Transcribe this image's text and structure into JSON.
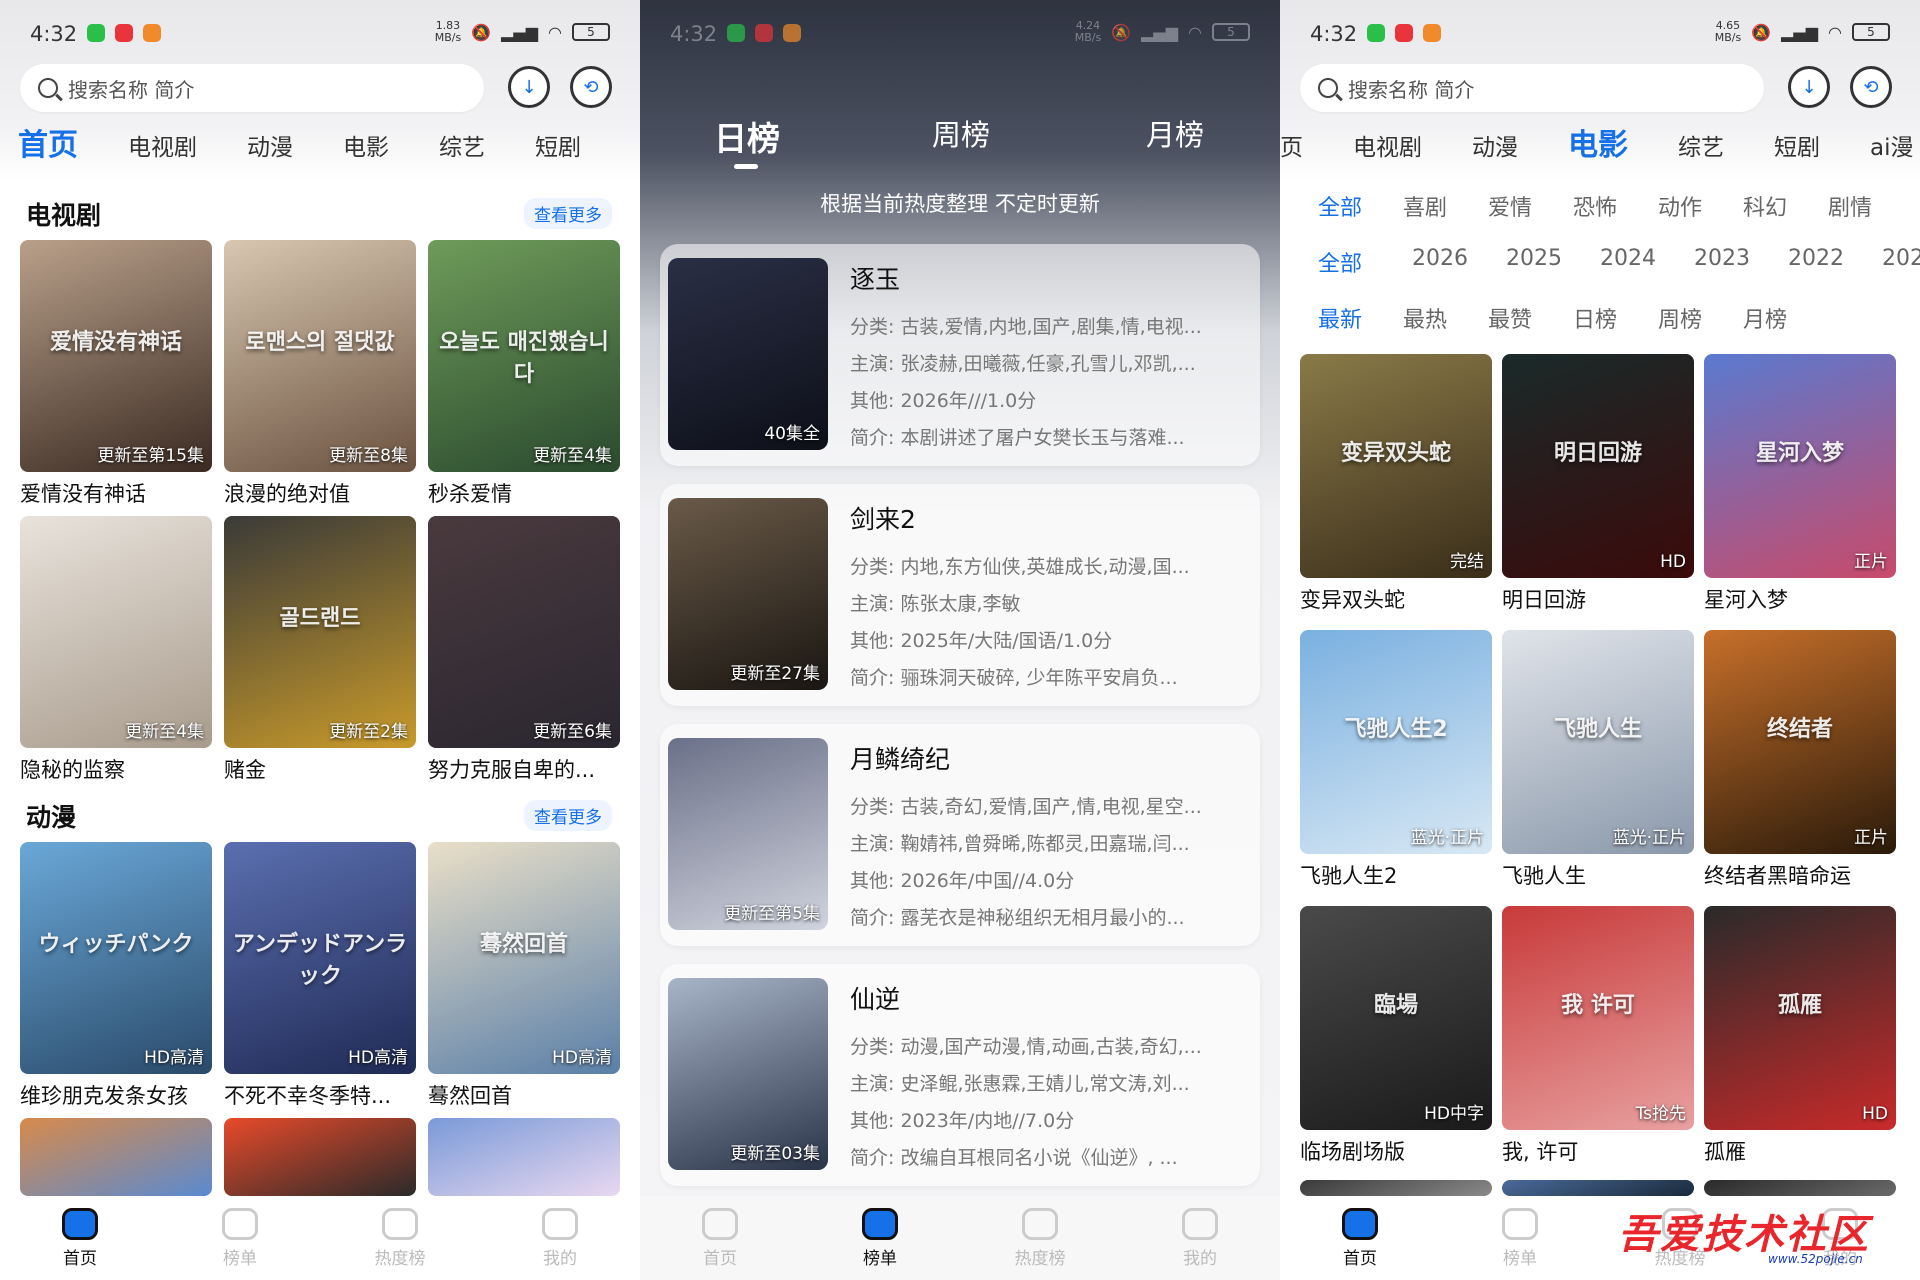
{
  "status": {
    "time": "4:32",
    "speed1": "1.83\nMB/s",
    "speed2": "4.24\nMB/s",
    "speed3": "4.65\nMB/s",
    "battery": "5"
  },
  "colors": {
    "accent": "#1670e8"
  },
  "home": {
    "search_placeholder": "搜索名称 简介",
    "tabs": [
      "首页",
      "电视剧",
      "动漫",
      "电影",
      "综艺",
      "短剧"
    ],
    "sections": [
      {
        "title": "电视剧",
        "more": "查看更多",
        "items": [
          {
            "title": "爱情没有神话",
            "badge": "更新至第15集",
            "poster_text": "爱情没有神话",
            "c1": "#b9a08a",
            "c2": "#3a2a22"
          },
          {
            "title": "浪漫的绝对值",
            "badge": "更新至8集",
            "poster_text": "로맨스의 절댓값",
            "c1": "#d8c7b0",
            "c2": "#6b5240"
          },
          {
            "title": "秒杀爱情",
            "badge": "更新至4集",
            "poster_text": "오늘도 매진했습니다",
            "c1": "#6f9b5a",
            "c2": "#2a4a2e"
          },
          {
            "title": "隐秘的监察",
            "badge": "更新至4集",
            "poster_text": "",
            "c1": "#e9e3dc",
            "c2": "#a89b8c"
          },
          {
            "title": "赌金",
            "badge": "更新至2集",
            "poster_text": "골드랜드",
            "c1": "#3a3a38",
            "c2": "#c89a2a"
          },
          {
            "title": "努力克服自卑的...",
            "badge": "更新至6集",
            "poster_text": "",
            "c1": "#4a3a3e",
            "c2": "#2a2630"
          }
        ]
      },
      {
        "title": "动漫",
        "more": "查看更多",
        "items": [
          {
            "title": "维珍朋克发条女孩",
            "badge": "HD高清",
            "poster_text": "ウィッチパンク",
            "c1": "#6aa8d8",
            "c2": "#2a4a6a"
          },
          {
            "title": "不死不幸冬季特...",
            "badge": "HD高清",
            "poster_text": "アンデッドアンラック",
            "c1": "#5b6fb0",
            "c2": "#1f2a55"
          },
          {
            "title": "蓦然回首",
            "badge": "HD高清",
            "poster_text": "蓦然回首",
            "c1": "#e9dfc8",
            "c2": "#5a7fa8"
          }
        ]
      }
    ],
    "extra_row": [
      {
        "c1": "#d88a4a",
        "c2": "#5a8ad0"
      },
      {
        "c1": "#e84a2a",
        "c2": "#2a2a2a"
      },
      {
        "c1": "#7a9ad8",
        "c2": "#e8d8f0"
      }
    ]
  },
  "rank": {
    "tabs": [
      "日榜",
      "周榜",
      "月榜"
    ],
    "subtitle": "根据当前热度整理 不定时更新",
    "items": [
      {
        "title": "逐玉",
        "badge": "40集全",
        "category": "分类:   古装,爱情,内地,国产,剧集,情,电视...",
        "cast": "主演:   张凌赫,田曦薇,任豪,孔雪儿,邓凯,...",
        "other": "其他:   2026年///1.0分",
        "intro": "简介:   本剧讲述了屠户女樊长玉与落难...",
        "c1": "#2a2f45",
        "c2": "#0d0f18"
      },
      {
        "title": "剑来2",
        "badge": "更新至27集",
        "category": "分类:   内地,东方仙侠,英雄成长,动漫,国...",
        "cast": "主演:   陈张太康,李敏",
        "other": "其他:   2025年/大陆/国语/1.0分",
        "intro": "简介:   骊珠洞天破碎, 少年陈平安肩负...",
        "c1": "#6a5a48",
        "c2": "#1a1612"
      },
      {
        "title": "月鳞绮纪",
        "badge": "更新至第5集",
        "category": "分类:   古装,奇幻,爱情,国产,情,电视,星空...",
        "cast": "主演:   鞠婧祎,曾舜晞,陈都灵,田嘉瑞,闫...",
        "other": "其他:   2026年/中国//4.0分",
        "intro": "简介:   露芜衣是神秘组织无相月最小的...",
        "c1": "#6a7088",
        "c2": "#d0d4de"
      },
      {
        "title": "仙逆",
        "badge": "更新至03集",
        "category": "分类:   动漫,国产动漫,情,动画,古装,奇幻,...",
        "cast": "主演:   史泽鲲,张惠霖,王婧儿,常文涛,刘...",
        "other": "其他:   2023年/内地//7.0分",
        "intro": "简介:   改编自耳根同名小说《仙逆》, ...",
        "c1": "#a8b4c8",
        "c2": "#2a3448"
      }
    ]
  },
  "movies": {
    "search_placeholder": "搜索名称 简介",
    "tabs": [
      "页",
      "电视剧",
      "动漫",
      "电影",
      "综艺",
      "短剧",
      "ai漫"
    ],
    "genres": [
      "全部",
      "喜剧",
      "爱情",
      "恐怖",
      "动作",
      "科幻",
      "剧情"
    ],
    "years": [
      "全部",
      "2026",
      "2025",
      "2024",
      "2023",
      "2022",
      "202"
    ],
    "sorts": [
      "最新",
      "最热",
      "最赞",
      "日榜",
      "周榜",
      "月榜"
    ],
    "items": [
      {
        "title": "变异双头蛇",
        "badge": "完结",
        "poster_text": "变异双头蛇",
        "c1": "#8a7a48",
        "c2": "#3a2e1a"
      },
      {
        "title": "明日回游",
        "badge": "HD",
        "poster_text": "明日回游",
        "c1": "#1a2a2a",
        "c2": "#3a0a0a"
      },
      {
        "title": "星河入梦",
        "badge": "正片",
        "poster_text": "星河入梦",
        "c1": "#5a7ad0",
        "c2": "#c84a6a"
      },
      {
        "title": "飞驰人生2",
        "badge": "蓝光·正片",
        "poster_text": "飞驰人生2",
        "c1": "#7ab0e0",
        "c2": "#d8e8f4"
      },
      {
        "title": "飞驰人生",
        "badge": "蓝光·正片",
        "poster_text": "飞驰人生",
        "c1": "#e0e4ea",
        "c2": "#8a98aa"
      },
      {
        "title": "终结者黑暗命运",
        "badge": "正片",
        "poster_text": "终结者",
        "c1": "#c8702a",
        "c2": "#2a1a0a"
      },
      {
        "title": "临场剧场版",
        "badge": "HD中字",
        "poster_text": "臨場",
        "c1": "#4a4a4a",
        "c2": "#1a1a1a"
      },
      {
        "title": "我, 许可",
        "badge": "Ts抢先",
        "poster_text": "我 许可",
        "c1": "#c83a3a",
        "c2": "#e8a0a0"
      },
      {
        "title": "孤雁",
        "badge": "HD",
        "poster_text": "孤雁",
        "c1": "#2a2a2a",
        "c2": "#c82a2a"
      }
    ],
    "extra_row": [
      {
        "c1": "#3a3a3a",
        "c2": "#8a8a8a"
      },
      {
        "c1": "#4a6a9a",
        "c2": "#1a2a3a"
      },
      {
        "c1": "#2a2a2a",
        "c2": "#6a6a6a"
      }
    ]
  },
  "nav": {
    "items": [
      "首页",
      "榜单",
      "热度榜",
      "我的"
    ]
  },
  "watermark": {
    "main": "吾爱技术社区",
    "url": "www.52pojie.cn"
  }
}
